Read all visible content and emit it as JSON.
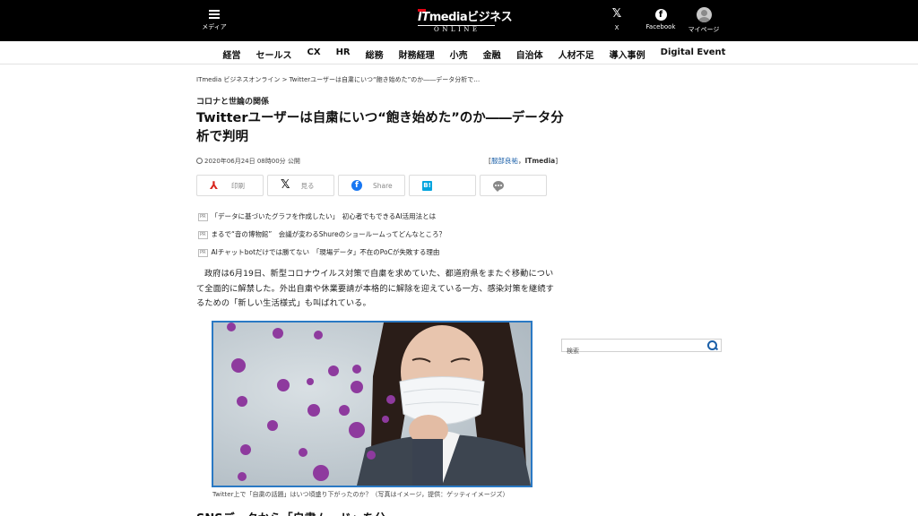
{
  "header": {
    "menu_label": "メディア",
    "logo_it": "IT",
    "logo_media": "media",
    "logo_biz": "ビジネス",
    "logo_sub": "ONLINE",
    "x_glyph": "𝕏",
    "x_label": "X",
    "fb_glyph": "f",
    "fb_label": "Facebook",
    "my_label": "マイページ"
  },
  "categories": [
    "経営",
    "セールス",
    "CX",
    "HR",
    "総務",
    "財務経理",
    "小売",
    "金融",
    "自治体",
    "人材不足",
    "導入事例",
    "Digital Event"
  ],
  "article": {
    "breadcrumb": "ITmedia ビジネスオンライン > Twitterユーザーは自粛にいつ“飽き始めた”のか――データ分析で…",
    "subtitle": "コロナと世論の関係",
    "title": "Twitterユーザーは自粛にいつ“飽き始めた”のか――データ分析で判明",
    "pubdate": "2020年06月24日 08時00分 公開",
    "author_open": "[",
    "author_name": "服部良祐",
    "author_sep": "，",
    "author_org": "ITmedia",
    "author_close": "]",
    "body": "政府は6月19日、新型コロナウイルス対策で自粛を求めていた、都道府県をまたぐ移動について全面的に解禁した。外出自粛や休業要請が本格的に解除を迎えている一方、感染対策を継続するための「新しい生活様式」も叫ばれている。",
    "caption": "Twitter上で「自粛の話題」はいつ頃盛り下がったのか？（写真はイメージ，提供：ゲッティイメージズ）",
    "next_heading": "SNSデータから「自粛ムード」を分…"
  },
  "share": {
    "print": "印刷",
    "x": "見る",
    "facebook": "Share",
    "hatena": "B!"
  },
  "pr": {
    "tag": "PR",
    "items": [
      "「データに基づいたグラフを作成したい」　初心者でもできるAI活用法とは",
      "まるで“音の博物館”　会議が変わるShureのショールームってどんなところ？",
      "AIチャットbotだけでは勝てない　「現場データ」不在のPoCが失敗する理由"
    ]
  },
  "search": {
    "placeholder": "検索"
  },
  "colors": {
    "header_bg": "#000000",
    "link": "#1a5fa8",
    "figure_border": "#2a79c4",
    "virus": "#8e3a9e"
  }
}
